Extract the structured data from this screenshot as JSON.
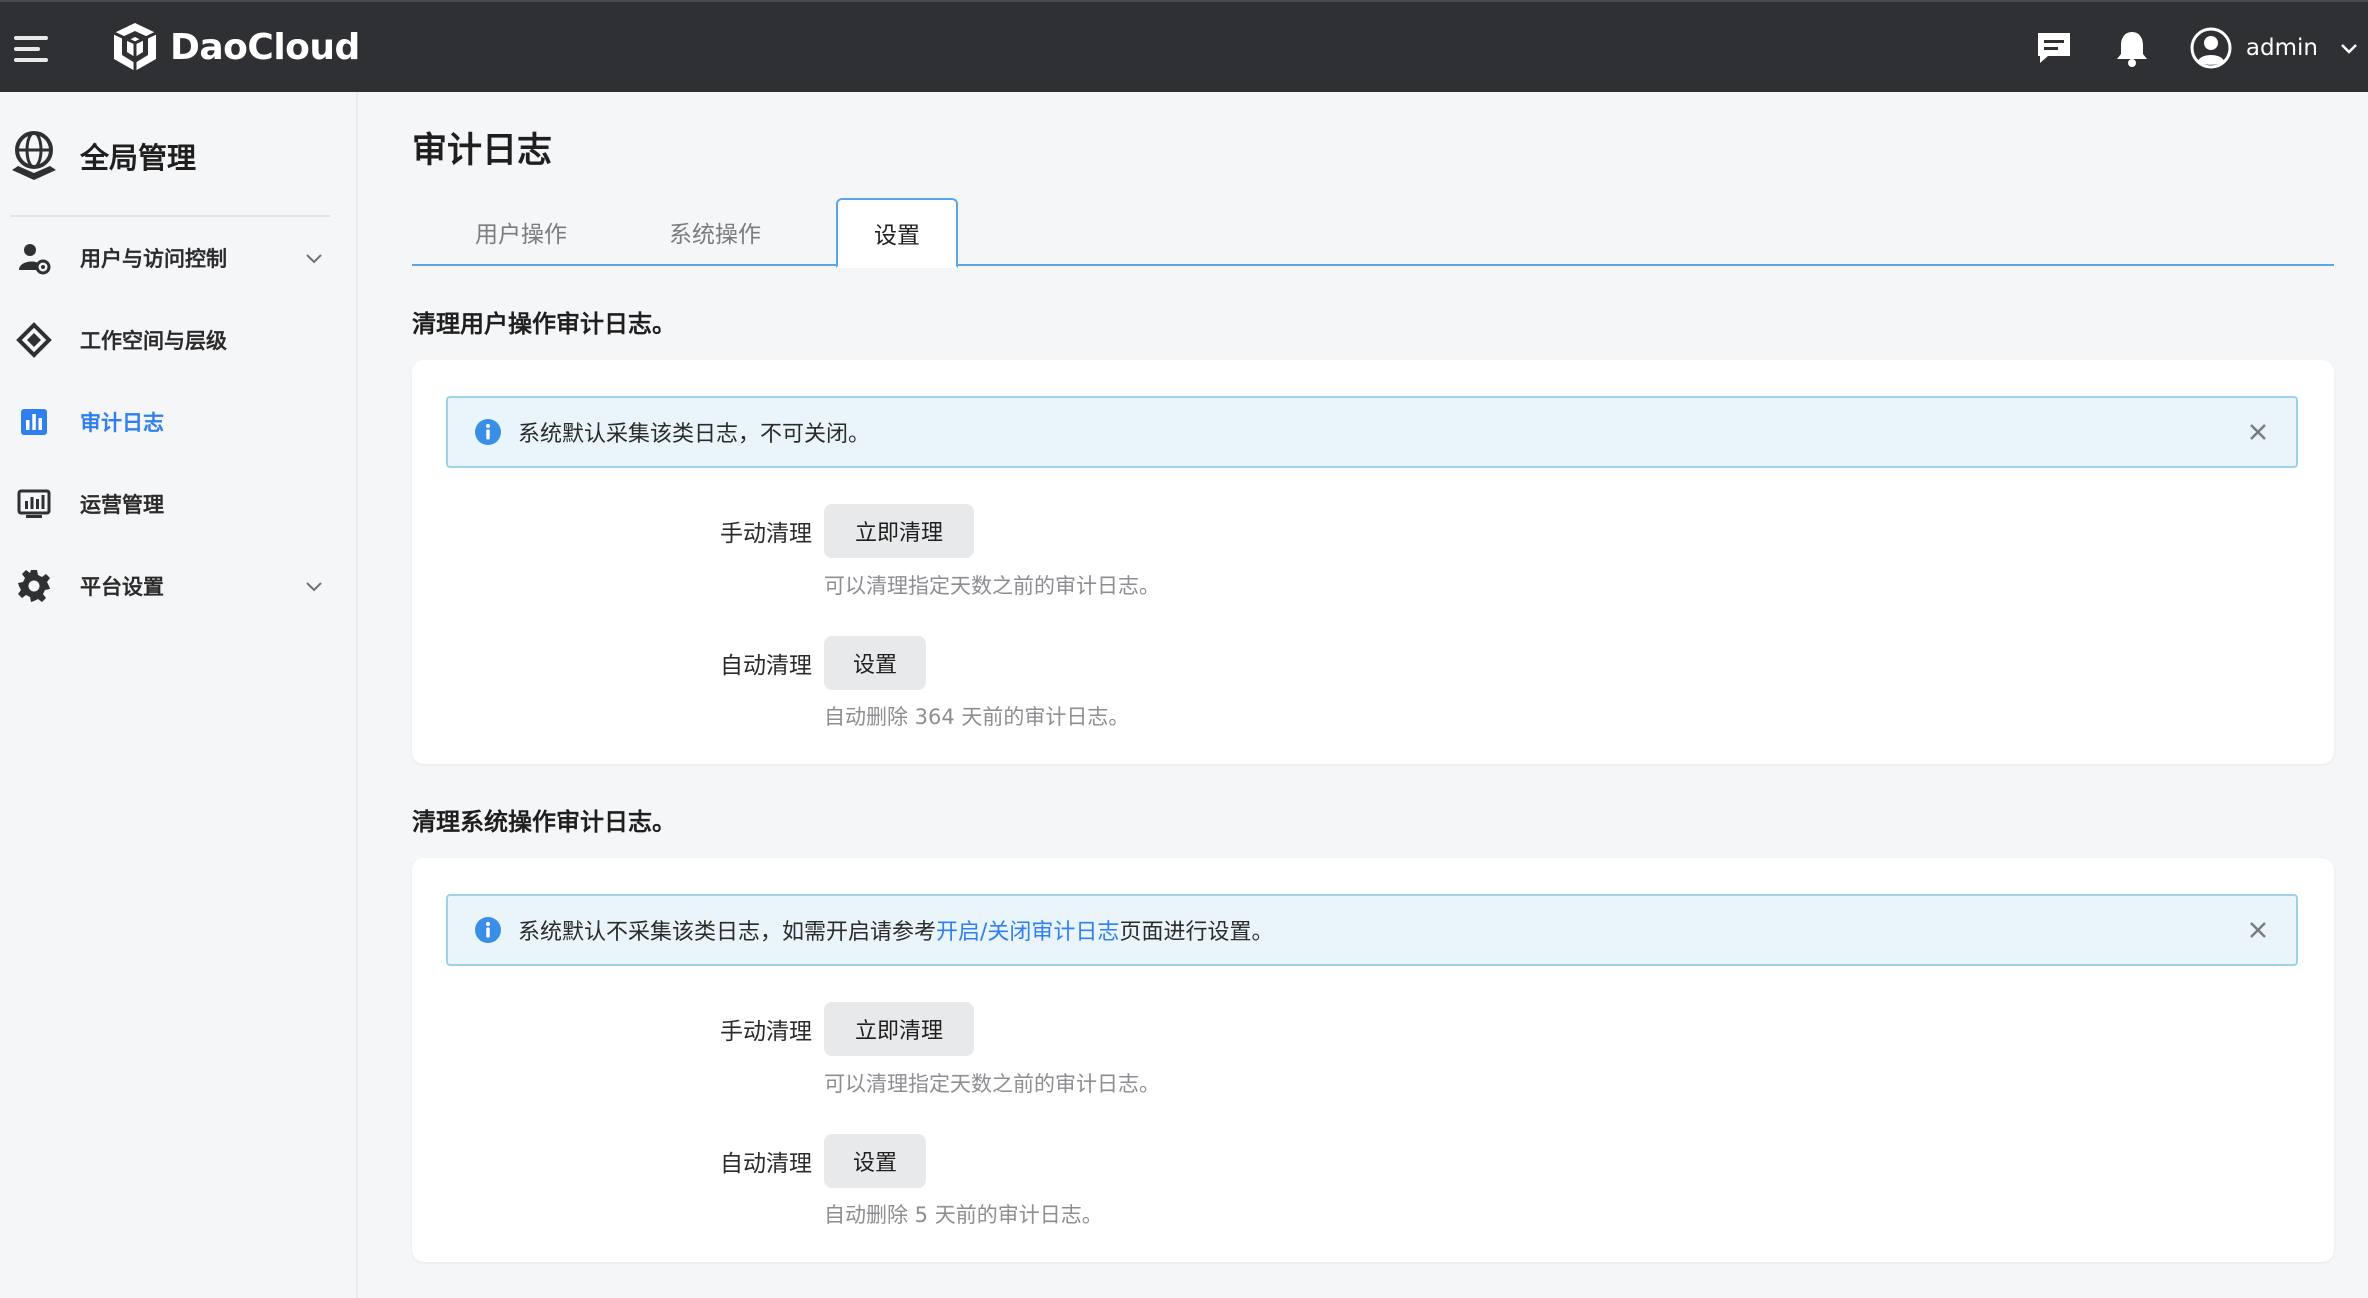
{
  "app": {
    "brand": "DaoCloud",
    "username": "admin"
  },
  "sidebar": {
    "title": "全局管理",
    "items": [
      {
        "label": "用户与访问控制",
        "icon": "user-gear-icon",
        "expandable": true
      },
      {
        "label": "工作空间与层级",
        "icon": "workspace-icon",
        "expandable": false
      },
      {
        "label": "审计日志",
        "icon": "bar-chart-icon",
        "expandable": false,
        "active": true
      },
      {
        "label": "运营管理",
        "icon": "monitor-chart-icon",
        "expandable": false
      },
      {
        "label": "平台设置",
        "icon": "gear-icon",
        "expandable": true
      }
    ]
  },
  "main": {
    "title": "审计日志",
    "tabs": [
      {
        "label": "用户操作"
      },
      {
        "label": "系统操作"
      },
      {
        "label": "设置",
        "active": true
      }
    ],
    "sections": [
      {
        "title": "清理用户操作审计日志。",
        "alert": {
          "text": "系统默认采集该类日志，不可关闭。"
        },
        "manual_label": "手动清理",
        "manual_button": "立即清理",
        "manual_hint": "可以清理指定天数之前的审计日志。",
        "auto_label": "自动清理",
        "auto_button": "设置",
        "auto_hint": "自动删除 364 天前的审计日志。"
      },
      {
        "title": "清理系统操作审计日志。",
        "alert": {
          "text_before": "系统默认不采集该类日志，如需开启请参考",
          "link": "开启/关闭审计日志",
          "text_after": "页面进行设置。"
        },
        "manual_label": "手动清理",
        "manual_button": "立即清理",
        "manual_hint": "可以清理指定天数之前的审计日志。",
        "auto_label": "自动清理",
        "auto_button": "设置",
        "auto_hint": "自动删除 5 天前的审计日志。"
      }
    ]
  },
  "colors": {
    "topbar": "#2f3033",
    "accent": "#2f7ff0",
    "alert_bg": "#eaf5fb",
    "alert_border": "#9fd1ef",
    "info_icon": "#3a8ee6"
  }
}
